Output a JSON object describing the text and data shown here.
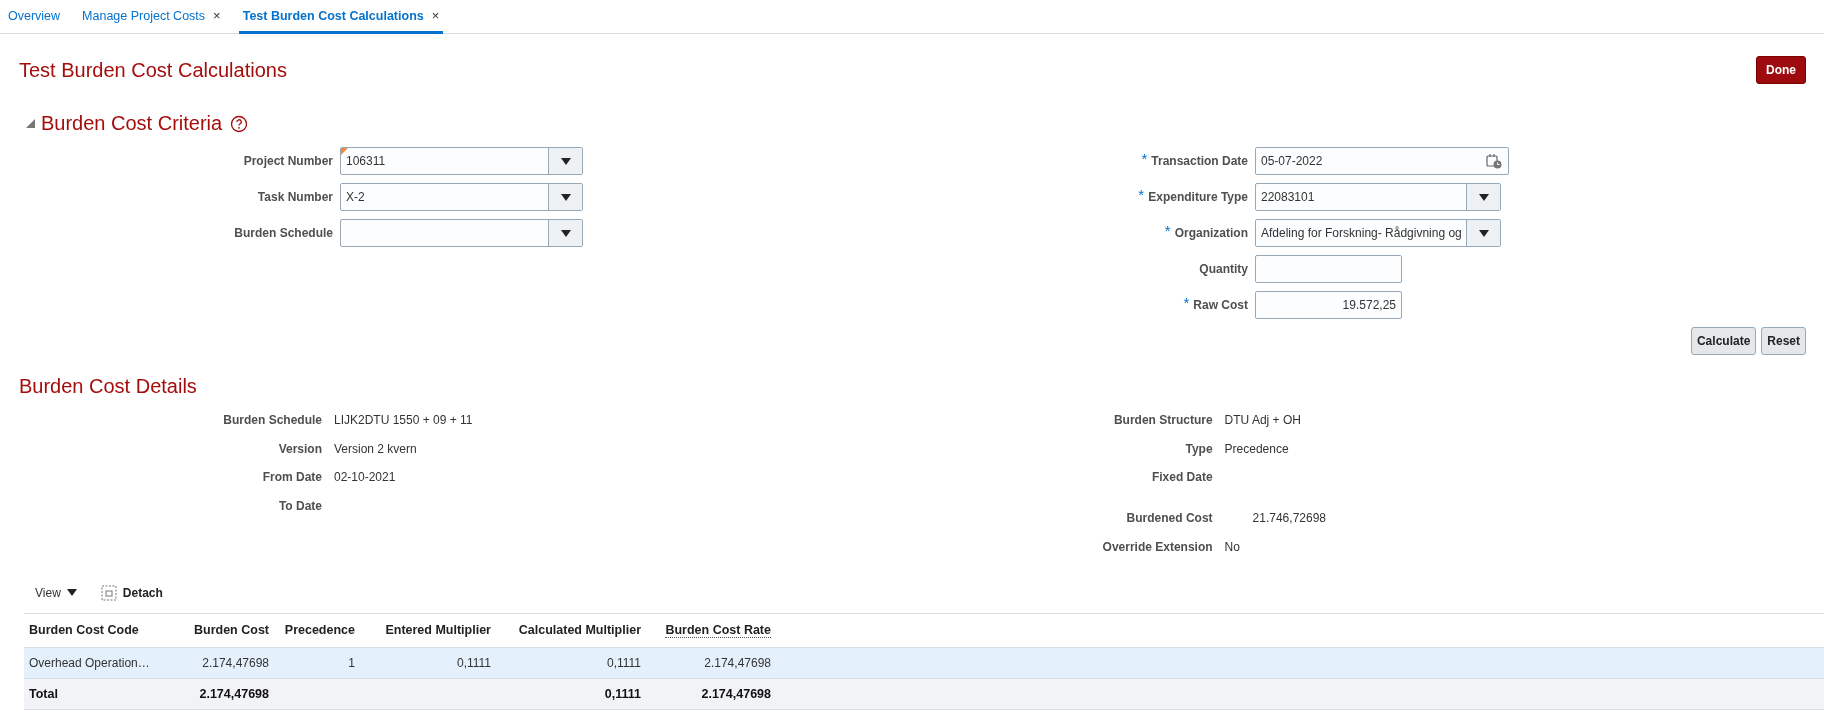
{
  "tabs": [
    {
      "label": "Overview",
      "selected": false
    },
    {
      "label": "Manage Project Costs",
      "selected": false,
      "close": "×"
    },
    {
      "label": "Test Burden Cost Calculations",
      "selected": true,
      "close": "×"
    }
  ],
  "page": {
    "title": "Test Burden Cost Calculations",
    "done_button": "Done"
  },
  "criteria": {
    "title": "Burden Cost Criteria",
    "expanded": true,
    "left_fields": [
      {
        "label": "Project Number",
        "kind": "select",
        "value": "106311",
        "modified": true
      },
      {
        "label": "Task Number",
        "kind": "select",
        "value": "X-2",
        "modified": false
      },
      {
        "label": "Burden Schedule",
        "kind": "select",
        "modified": false
      }
    ],
    "right_fields": [
      {
        "label": "Transaction Date",
        "kind": "date",
        "value": "05-07-2022",
        "required_mark": "*",
        "modified": false
      },
      {
        "label": "Expenditure Type",
        "kind": "select",
        "value": "22083101",
        "required_mark": "*",
        "modified": false
      },
      {
        "label": "Organization",
        "kind": "select",
        "value": "Afdeling for Forskning- Rådgivning og",
        "required_mark": "*",
        "modified": false
      },
      {
        "label": "Quantity",
        "kind": "number",
        "modified": false
      },
      {
        "label": "Raw Cost",
        "kind": "number",
        "value": "19.572,25",
        "required_mark": "*",
        "modified": false
      }
    ],
    "buttons": [
      "Calculate",
      "Reset"
    ]
  },
  "details": {
    "title": "Burden Cost Details",
    "left": [
      {
        "label": "Burden Schedule",
        "value": "LIJK2DTU 1550 + 09 + 11"
      },
      {
        "label": "Version",
        "value": "Version 2 kvern"
      },
      {
        "label": "From Date",
        "value": "02-10-2021"
      },
      {
        "label": "To Date"
      }
    ],
    "right": [
      {
        "label": "Burden Structure",
        "value": "DTU Adj + OH"
      },
      {
        "label": "Type",
        "value": "Precedence"
      },
      {
        "label": "Fixed Date"
      }
    ],
    "right_lower": [
      {
        "label": "Burdened Cost",
        "value": "21.746,72698",
        "indented": true
      },
      {
        "label": "Override Extension",
        "value": "No",
        "indented": false
      }
    ]
  },
  "toolbar": {
    "view": "View",
    "detach": "Detach"
  },
  "table": {
    "columns": [
      {
        "label": "Burden Cost Code",
        "underlined": false
      },
      {
        "label": "Burden Cost",
        "underlined": false
      },
      {
        "label": "Precedence",
        "underlined": false
      },
      {
        "label": "Entered Multiplier",
        "underlined": false
      },
      {
        "label": "Calculated Multiplier",
        "underlined": false
      },
      {
        "label": "Burden Cost Rate",
        "underlined": true
      }
    ],
    "rows": [
      {
        "selected": true,
        "cells": [
          "Overhead Operation…",
          "2.174,47698",
          "1",
          "0,1111",
          "0,1111",
          "2.174,47698"
        ]
      }
    ],
    "total": {
      "cells": [
        "Total",
        "2.174,47698",
        "",
        "",
        "0,1111",
        "2.174,47698"
      ]
    }
  }
}
